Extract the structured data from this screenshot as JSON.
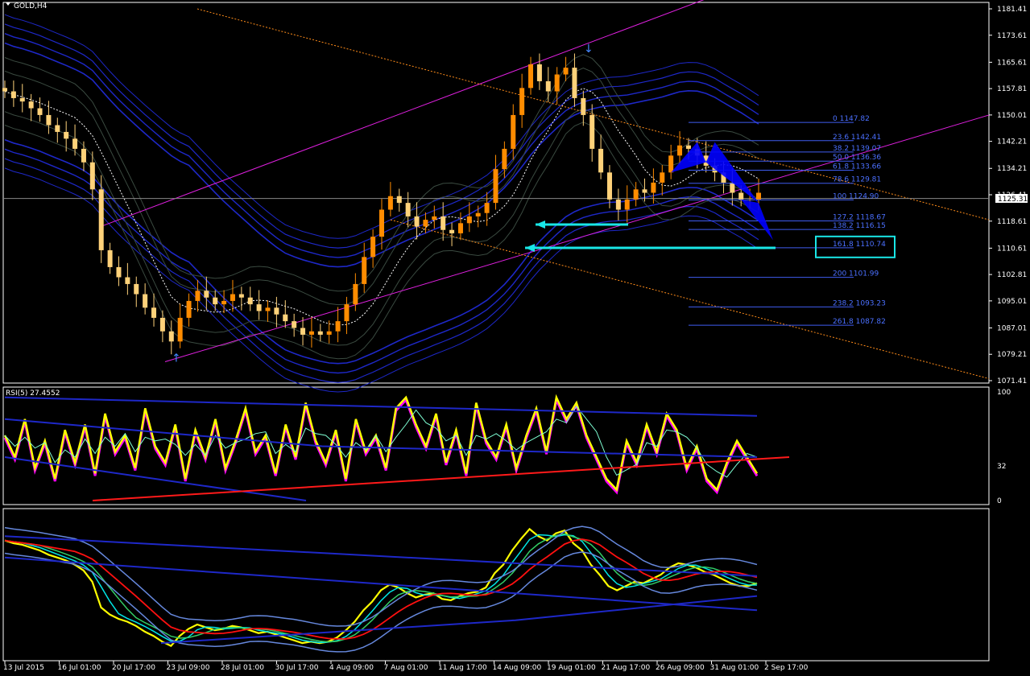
{
  "colors": {
    "background": "#000000",
    "frame": "#ffffff",
    "bull_candle": "#ff8c00",
    "bear_candle": "#ffd27a",
    "envelope": "#1e28c8",
    "bollinger": "#3a4a40",
    "channel": "#e020e0",
    "trend_dotted": "#ff8c1a",
    "fib": "#3f5cf0",
    "arrow_cyan": "#19e6e6",
    "rsi_main": "#ffff00",
    "rsi_alt": "#ff00ff",
    "rsi_trend": "#ff1a1a"
  },
  "chart_data": [
    {
      "type": "line",
      "name_label": "GOLD,H4",
      "y_ticks": [
        "1181.41",
        "1173.61",
        "1165.61",
        "1157.81",
        "1150.01",
        "1142.21",
        "1134.21",
        "1126.41",
        "1118.61",
        "1110.61",
        "1102.81",
        "1095.01",
        "1087.01",
        "1079.21",
        "1071.41"
      ],
      "ylim": [
        1071.41,
        1181.41
      ],
      "current_price": "1125.31",
      "x_ticks": [
        "13 Jul 2015",
        "16 Jul 01:00",
        "20 Jul 17:00",
        "23 Jul 09:00",
        "28 Jul 01:00",
        "30 Jul 17:00",
        "4 Aug 09:00",
        "7 Aug 01:00",
        "11 Aug 17:00",
        "14 Aug 09:00",
        "19 Aug 01:00",
        "21 Aug 17:00",
        "26 Aug 09:00",
        "31 Aug 01:00",
        "2 Sep 17:00"
      ],
      "close_series": [
        1157,
        1155,
        1154,
        1152,
        1150,
        1147,
        1145,
        1143,
        1140,
        1136,
        1128,
        1110,
        1105,
        1102,
        1100,
        1097,
        1093,
        1090,
        1086,
        1083,
        1090,
        1095,
        1098,
        1096,
        1094,
        1095,
        1097,
        1096,
        1094,
        1092,
        1093,
        1091,
        1089,
        1087,
        1085,
        1086,
        1085,
        1086,
        1089,
        1094,
        1100,
        1108,
        1114,
        1122,
        1126,
        1124,
        1120,
        1117,
        1119,
        1120,
        1116,
        1115,
        1118,
        1120,
        1121,
        1124,
        1134,
        1140,
        1150,
        1158,
        1165,
        1160,
        1157,
        1162,
        1164,
        1155,
        1150,
        1140,
        1133,
        1125,
        1122,
        1125,
        1128,
        1127,
        1130,
        1133,
        1138,
        1141,
        1140,
        1138,
        1135,
        1133,
        1130,
        1127,
        1125,
        1125,
        1127
      ],
      "fibonacci": [
        {
          "label": "0 1147.82",
          "price": 1147.82
        },
        {
          "label": "23.6 1142.41",
          "price": 1142.41
        },
        {
          "label": "38.2 1139.07",
          "price": 1139.07
        },
        {
          "label": "50.0 1136.36",
          "price": 1136.36
        },
        {
          "label": "61.8 1133.66",
          "price": 1133.66
        },
        {
          "label": "78.6 1129.81",
          "price": 1129.81
        },
        {
          "label": "100 1124.90",
          "price": 1124.9
        },
        {
          "label": "127.2 1118.67",
          "price": 1118.67
        },
        {
          "label": "138.2 1116.15",
          "price": 1116.15
        },
        {
          "label": "161.8 1110.74",
          "price": 1110.74,
          "highlight": true
        },
        {
          "label": "200 1101.99",
          "price": 1101.99
        },
        {
          "label": "238.2 1093.23",
          "price": 1093.23
        },
        {
          "label": "261.8 1087.82",
          "price": 1087.82
        }
      ]
    },
    {
      "type": "line",
      "name_label": "RSI(5) 27.4552",
      "ylim": [
        0,
        100
      ],
      "y_ticks": [
        "100",
        "32",
        "0"
      ],
      "series": [
        {
          "values": [
            60,
            40,
            75,
            30,
            55,
            20,
            65,
            35,
            70,
            25,
            80,
            45,
            60,
            30,
            85,
            50,
            35,
            70,
            20,
            65,
            40,
            75,
            30,
            55,
            85,
            45,
            60,
            25,
            70,
            40,
            90,
            55,
            35,
            65,
            20,
            75,
            45,
            60,
            30,
            85,
            95,
            70,
            50,
            80,
            35,
            65,
            25,
            90,
            55,
            40,
            70,
            30,
            60,
            85,
            45,
            95,
            75,
            90,
            60,
            40,
            20,
            10,
            55,
            35,
            70,
            45,
            80,
            65,
            30,
            50,
            20,
            10,
            35,
            55,
            40,
            25
          ]
        }
      ]
    }
  ]
}
